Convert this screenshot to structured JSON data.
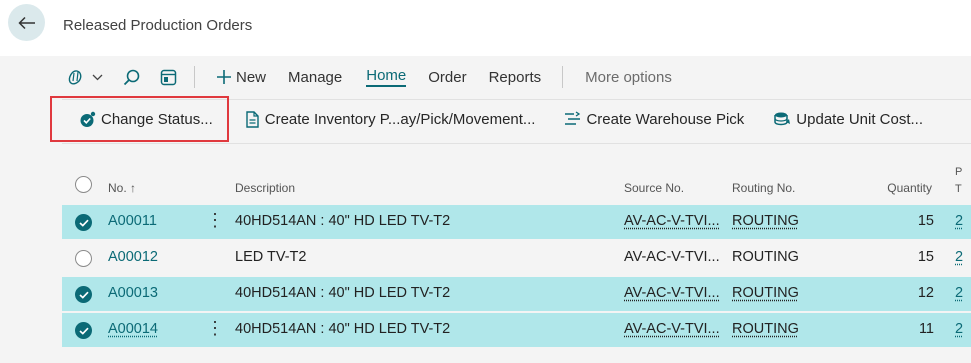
{
  "header": {
    "title": "Released Production Orders"
  },
  "actionbar": {
    "new_label": "New",
    "manage_label": "Manage",
    "home_label": "Home",
    "order_label": "Order",
    "reports_label": "Reports",
    "more_label": "More options"
  },
  "promoted": {
    "change_status": "Change Status...",
    "create_inventory": "Create Inventory P...ay/Pick/Movement...",
    "create_warehouse_pick": "Create Warehouse Pick",
    "update_unit_cost": "Update Unit Cost..."
  },
  "grid": {
    "columns": {
      "no": "No. ↑",
      "description": "Description",
      "source_no": "Source No.",
      "routing_no": "Routing No.",
      "quantity": "Quantity",
      "extra_top": "P",
      "extra_bottom": "T"
    },
    "rows": [
      {
        "no": "A00011",
        "description": "40HD514AN : 40\" HD LED TV-T2",
        "source_no": "AV-AC-V-TVI...",
        "routing_no": "ROUTING",
        "quantity": "15",
        "extra": "2",
        "selected": true
      },
      {
        "no": "A00012",
        "description": "LED TV-T2",
        "source_no": "AV-AC-V-TVI...",
        "routing_no": "ROUTING",
        "quantity": "15",
        "extra": "2",
        "selected": false
      },
      {
        "no": "A00013",
        "description": "40HD514AN : 40\" HD LED TV-T2",
        "source_no": "AV-AC-V-TVI...",
        "routing_no": "ROUTING",
        "quantity": "12",
        "extra": "2",
        "selected": true
      },
      {
        "no": "A00014",
        "description": "40HD514AN : 40\" HD LED TV-T2",
        "source_no": "AV-AC-V-TVI...",
        "routing_no": "ROUTING",
        "quantity": "11",
        "extra": "2",
        "selected": true
      }
    ]
  },
  "colors": {
    "accent": "#0b6a76",
    "selected_row": "#b0e7ea",
    "highlight_box": "#e0393e"
  }
}
